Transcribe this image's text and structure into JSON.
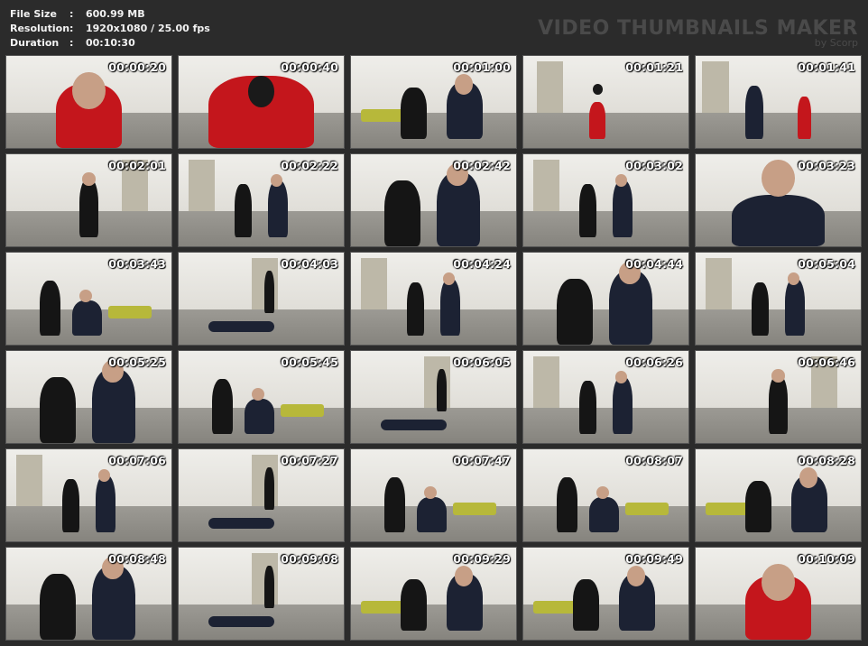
{
  "file_info": {
    "file_size_label": "File Size",
    "file_size_value": "600.99 MB",
    "resolution_label": "Resolution",
    "resolution_value": "1920x1080 / 25.00 fps",
    "duration_label": "Duration",
    "duration_value": "00:10:30",
    "separator": ":"
  },
  "watermark": {
    "title": "VIDEO THUMBNAILS MAKER",
    "byline": "by Scorp"
  },
  "thumbnails": [
    {
      "timestamp": "00:00:20",
      "scene": "closeup-red"
    },
    {
      "timestamp": "00:00:40",
      "scene": "hands-up-red"
    },
    {
      "timestamp": "00:01:00",
      "scene": "duo-sofa"
    },
    {
      "timestamp": "00:01:21",
      "scene": "hands-up-wide"
    },
    {
      "timestamp": "00:01:41",
      "scene": "walk-wide"
    },
    {
      "timestamp": "00:02:01",
      "scene": "single-black"
    },
    {
      "timestamp": "00:02:22",
      "scene": "duo-wide"
    },
    {
      "timestamp": "00:02:42",
      "scene": "duo-close"
    },
    {
      "timestamp": "00:03:02",
      "scene": "duo-wide"
    },
    {
      "timestamp": "00:03:23",
      "scene": "man-close"
    },
    {
      "timestamp": "00:03:43",
      "scene": "duo-kneel"
    },
    {
      "timestamp": "00:04:03",
      "scene": "man-floor"
    },
    {
      "timestamp": "00:04:24",
      "scene": "duo-wide"
    },
    {
      "timestamp": "00:04:44",
      "scene": "duo-close"
    },
    {
      "timestamp": "00:05:04",
      "scene": "duo-wide"
    },
    {
      "timestamp": "00:05:25",
      "scene": "duo-close"
    },
    {
      "timestamp": "00:05:45",
      "scene": "duo-kneel"
    },
    {
      "timestamp": "00:06:05",
      "scene": "man-floor"
    },
    {
      "timestamp": "00:06:26",
      "scene": "duo-wide"
    },
    {
      "timestamp": "00:06:46",
      "scene": "single-black"
    },
    {
      "timestamp": "00:07:06",
      "scene": "duo-wide"
    },
    {
      "timestamp": "00:07:27",
      "scene": "man-floor"
    },
    {
      "timestamp": "00:07:47",
      "scene": "duo-kneel"
    },
    {
      "timestamp": "00:08:07",
      "scene": "duo-kneel"
    },
    {
      "timestamp": "00:08:28",
      "scene": "duo-sofa"
    },
    {
      "timestamp": "00:08:48",
      "scene": "duo-close"
    },
    {
      "timestamp": "00:09:08",
      "scene": "man-floor"
    },
    {
      "timestamp": "00:09:29",
      "scene": "duo-sofa"
    },
    {
      "timestamp": "00:09:49",
      "scene": "duo-sofa"
    },
    {
      "timestamp": "00:10:09",
      "scene": "closeup-red"
    }
  ],
  "colors": {
    "background": "#2b2b2b",
    "info_text": "#f2f2f2",
    "watermark": "#4a4a4a",
    "timestamp": "#ffffff"
  }
}
